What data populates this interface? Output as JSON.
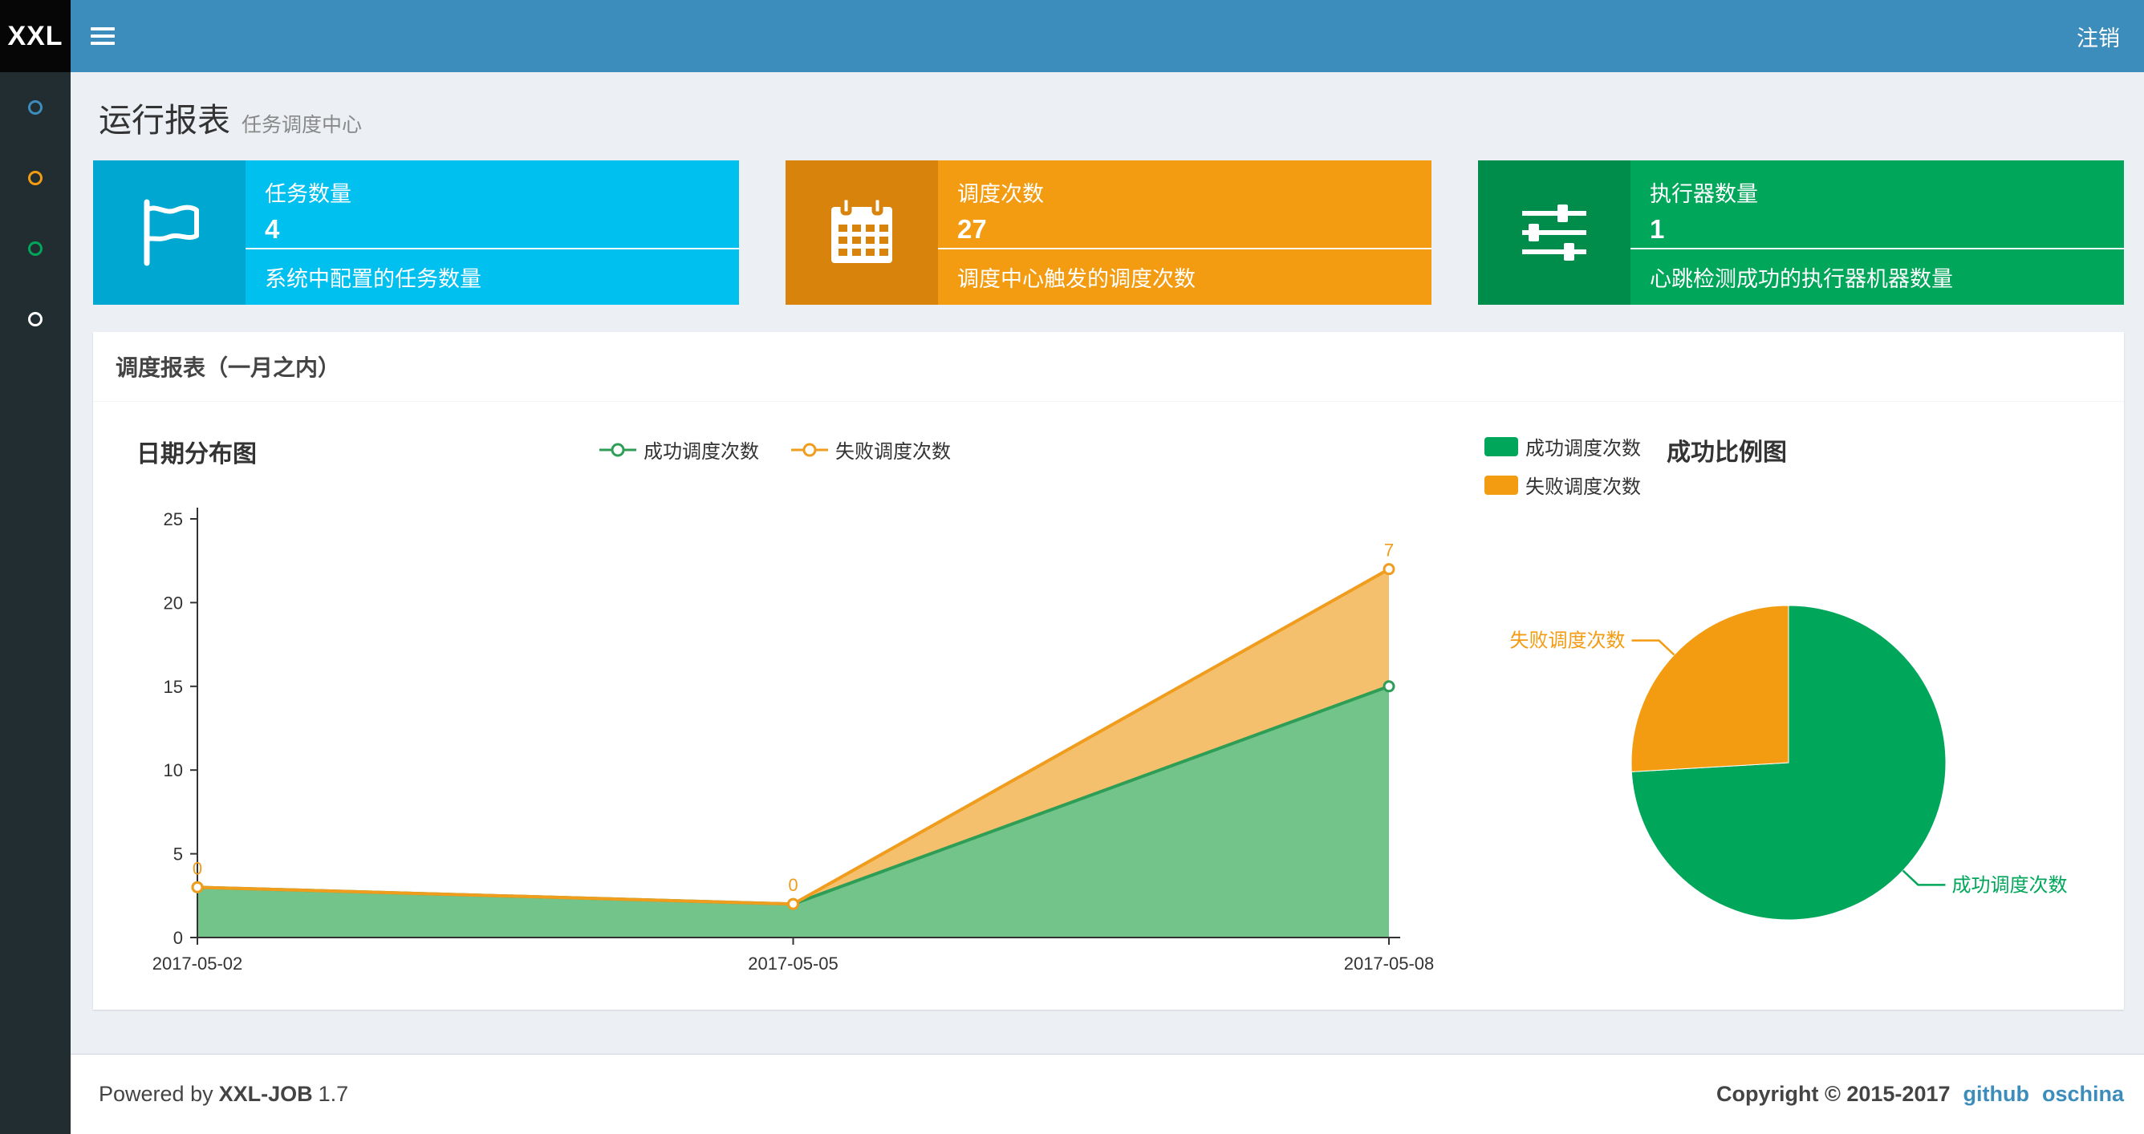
{
  "navbar": {
    "logo": "XXL",
    "logout": "注销"
  },
  "sidebar": {
    "items": [
      {
        "name": "menu-item-1",
        "color": "#3c8dbc"
      },
      {
        "name": "menu-item-2",
        "color": "#f39c12"
      },
      {
        "name": "menu-item-3",
        "color": "#00a65a"
      },
      {
        "name": "menu-item-4",
        "color": "#ffffff"
      }
    ]
  },
  "page": {
    "title": "运行报表",
    "subtitle": "任务调度中心"
  },
  "info_boxes": [
    {
      "title": "任务数量",
      "value": "4",
      "desc": "系统中配置的任务数量",
      "color": "#00c0ef",
      "icon_bg": "#00a7d0",
      "icon": "flag-icon"
    },
    {
      "title": "调度次数",
      "value": "27",
      "desc": "调度中心触发的调度次数",
      "color": "#f39c12",
      "icon_bg": "#d8830b",
      "icon": "calendar-icon"
    },
    {
      "title": "执行器数量",
      "value": "1",
      "desc": "心跳检测成功的执行器机器数量",
      "color": "#00a65a",
      "icon_bg": "#008d4c",
      "icon": "sliders-icon"
    }
  ],
  "report_box": {
    "title": "调度报表（一月之内）"
  },
  "chart_data": [
    {
      "type": "area",
      "title": "日期分布图",
      "categories": [
        "2017-05-02",
        "2017-05-05",
        "2017-05-08"
      ],
      "series": [
        {
          "name": "成功调度次数",
          "values": [
            3,
            2,
            15
          ],
          "color": "#2e9e57",
          "fill": "#64be7d"
        },
        {
          "name": "失败调度次数",
          "values": [
            0,
            0,
            7
          ],
          "color": "#f09d1e",
          "fill": "#f3b95e",
          "labels": [
            "0",
            "0",
            "7"
          ]
        }
      ],
      "stacked": true,
      "ylim": [
        0,
        25
      ],
      "yticks": [
        0,
        5,
        10,
        15,
        20,
        25
      ],
      "grid": false,
      "legend_position": "top"
    },
    {
      "type": "pie",
      "title": "成功比例图",
      "slices": [
        {
          "name": "成功调度次数",
          "value": 20,
          "color": "#00a65a"
        },
        {
          "name": "失败调度次数",
          "value": 7,
          "color": "#f39c12"
        }
      ],
      "legend_position": "top-left"
    }
  ],
  "footer": {
    "powered_prefix": "Powered by",
    "product": "XXL-JOB",
    "version": "1.7",
    "copyright": "Copyright © 2015-2017",
    "links": [
      "github",
      "oschina"
    ]
  }
}
